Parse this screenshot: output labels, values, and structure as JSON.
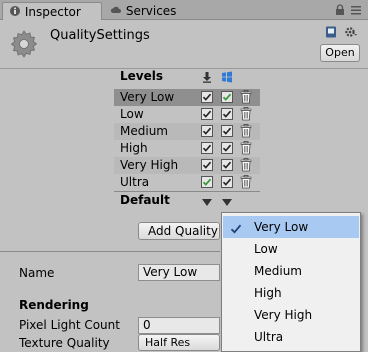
{
  "tabs": [
    {
      "label": "Inspector"
    },
    {
      "label": "Services"
    }
  ],
  "header": {
    "title": "QualitySettings",
    "open_label": "Open"
  },
  "levels": {
    "heading": "Levels",
    "rows": [
      {
        "name": "Very Low",
        "standalone": true,
        "web": true
      },
      {
        "name": "Low",
        "standalone": true,
        "web": true
      },
      {
        "name": "Medium",
        "standalone": true,
        "web": true
      },
      {
        "name": "High",
        "standalone": true,
        "web": true
      },
      {
        "name": "Very High",
        "standalone": true,
        "web": true
      },
      {
        "name": "Ultra",
        "standalone": true,
        "web": true
      }
    ],
    "default_label": "Default",
    "add_label": "Add Quality"
  },
  "props": {
    "name_label": "Name",
    "name_value": "Very Low",
    "rendering_title": "Rendering",
    "pixel_light_label": "Pixel Light Count",
    "pixel_light_value": "0",
    "texture_quality_label": "Texture Quality",
    "texture_quality_value": "Half Res"
  },
  "dropdown": {
    "items": [
      {
        "label": "Very Low",
        "selected": true
      },
      {
        "label": "Low",
        "selected": false
      },
      {
        "label": "Medium",
        "selected": false
      },
      {
        "label": "High",
        "selected": false
      },
      {
        "label": "Very High",
        "selected": false
      },
      {
        "label": "Ultra",
        "selected": false
      }
    ]
  },
  "colors": {
    "panel": "#c2c2c2",
    "selected_row": "#8f8f8f",
    "dropdown_highlight": "#a8c9f2",
    "default_check": "#3c9a3c"
  }
}
